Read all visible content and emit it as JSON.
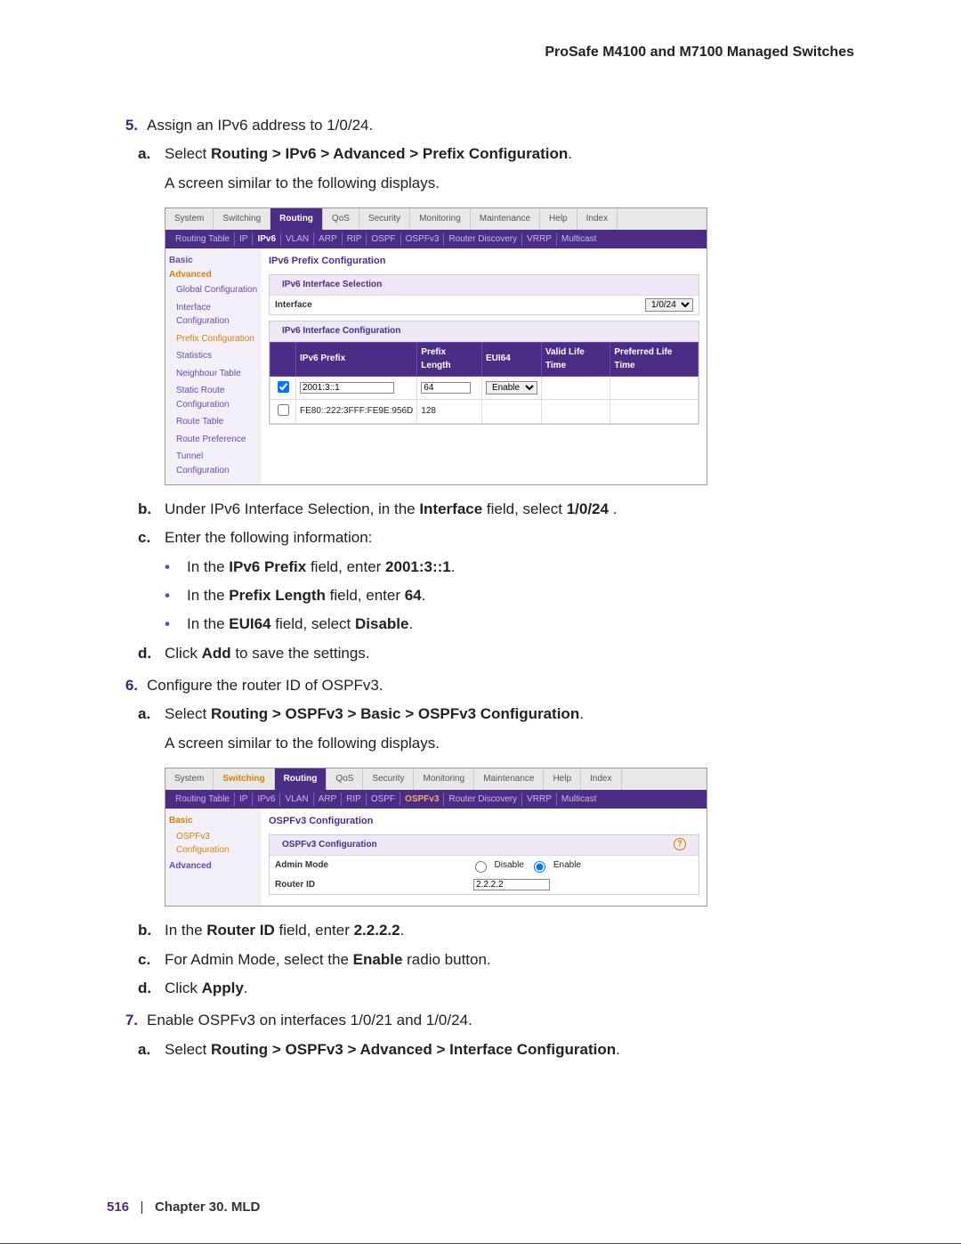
{
  "header": {
    "title": "ProSafe M4100 and M7100 Managed Switches"
  },
  "steps": {
    "s5": {
      "num": "5.",
      "text": "Assign an IPv6 address to 1/0/24.",
      "a_num": "a.",
      "a_pre": "Select ",
      "a_bold": "Routing > IPv6 > Advanced > Prefix Configuration",
      "a_post": ".",
      "a_desc": "A screen similar to the following displays.",
      "b_num": "b.",
      "b_pre": "Under IPv6 Interface Selection, in the ",
      "b_b1": "Interface",
      "b_mid": " field, select ",
      "b_b2": "1/0/24",
      "b_post": " .",
      "c_num": "c.",
      "c_text": "Enter the following information:",
      "c1_pre": "In the ",
      "c1_b1": "IPv6 Prefix",
      "c1_mid": " field, enter ",
      "c1_b2": "2001:3::1",
      "c1_post": ".",
      "c2_pre": "In the ",
      "c2_b1": "Prefix Length",
      "c2_mid": " field, enter ",
      "c2_b2": "64",
      "c2_post": ".",
      "c3_pre": "In the ",
      "c3_b1": "EUI64",
      "c3_mid": " field, select ",
      "c3_b2": "Disable",
      "c3_post": ".",
      "d_num": "d.",
      "d_pre": "Click ",
      "d_b": "Add",
      "d_post": " to save the settings."
    },
    "s6": {
      "num": "6.",
      "text": "Configure the router ID of OSPFv3.",
      "a_num": "a.",
      "a_pre": "Select ",
      "a_bold": "Routing > OSPFv3 > Basic > OSPFv3 Configuration",
      "a_post": ".",
      "a_desc": "A screen similar to the following displays.",
      "b_num": "b.",
      "b_pre": "In the ",
      "b_b1": "Router ID",
      "b_mid": " field, enter ",
      "b_b2": "2.2.2.2",
      "b_post": ".",
      "c_num": "c.",
      "c_pre": "For Admin Mode, select the ",
      "c_b": "Enable",
      "c_post": " radio button.",
      "d_num": "d.",
      "d_pre": "Click ",
      "d_b": "Apply",
      "d_post": "."
    },
    "s7": {
      "num": "7.",
      "text": "Enable OSPFv3 on interfaces 1/0/21 and 1/0/24.",
      "a_num": "a.",
      "a_pre": "Select ",
      "a_bold": "Routing > OSPFv3 > Advanced > Interface Configuration",
      "a_post": "."
    }
  },
  "app1": {
    "tabs": [
      "System",
      "Switching",
      "Routing",
      "QoS",
      "Security",
      "Monitoring",
      "Maintenance",
      "Help",
      "Index"
    ],
    "active_tab": "Routing",
    "subtabs": [
      "Routing Table",
      "IP",
      "IPv6",
      "VLAN",
      "ARP",
      "RIP",
      "OSPF",
      "OSPFv3",
      "Router Discovery",
      "VRRP",
      "Multicast"
    ],
    "active_subtab": "IPv6",
    "side": {
      "basic": "Basic",
      "advanced": "Advanced",
      "items": [
        "Global Configuration",
        "Interface Configuration",
        "Prefix Configuration",
        "Statistics",
        "Neighbour Table",
        "Static Route Configuration",
        "Route Table",
        "Route Preference",
        "Tunnel Configuration"
      ],
      "highlight": "Prefix Configuration"
    },
    "main_title": "IPv6 Prefix Configuration",
    "panel1_head": "IPv6 Interface Selection",
    "panel1_label": "Interface",
    "panel1_value": "1/0/24",
    "panel2_head": "IPv6 Interface Configuration",
    "table_headers": [
      "",
      "IPv6 Prefix",
      "Prefix Length",
      "EUI64",
      "Valid Life Time",
      "Preferred Life Time"
    ],
    "row1": {
      "prefix": "2001:3::1",
      "len": "64",
      "eui": "Enable"
    },
    "row2": {
      "prefix": "FE80::222:3FFF:FE9E:956D",
      "len": "128"
    }
  },
  "app2": {
    "tabs": [
      "System",
      "Switching",
      "Routing",
      "QoS",
      "Security",
      "Monitoring",
      "Maintenance",
      "Help",
      "Index"
    ],
    "active_tab": "Routing",
    "highlight_tab": "Switching",
    "subtabs": [
      "Routing Table",
      "IP",
      "IPv6",
      "VLAN",
      "ARP",
      "RIP",
      "OSPF",
      "OSPFv3",
      "Router Discovery",
      "VRRP",
      "Multicast"
    ],
    "active_subtab": "OSPFv3",
    "side": {
      "basic": "Basic",
      "item1": "OSPFv3 Configuration",
      "advanced": "Advanced"
    },
    "main_title": "OSPFv3 Configuration",
    "panel_head": "OSPFv3 Configuration",
    "admin_label": "Admin Mode",
    "admin_disable": "Disable",
    "admin_enable": "Enable",
    "router_label": "Router ID",
    "router_value": "2.2.2.2"
  },
  "footer": {
    "page": "516",
    "sep": "|",
    "chapter": "Chapter 30.  MLD"
  }
}
